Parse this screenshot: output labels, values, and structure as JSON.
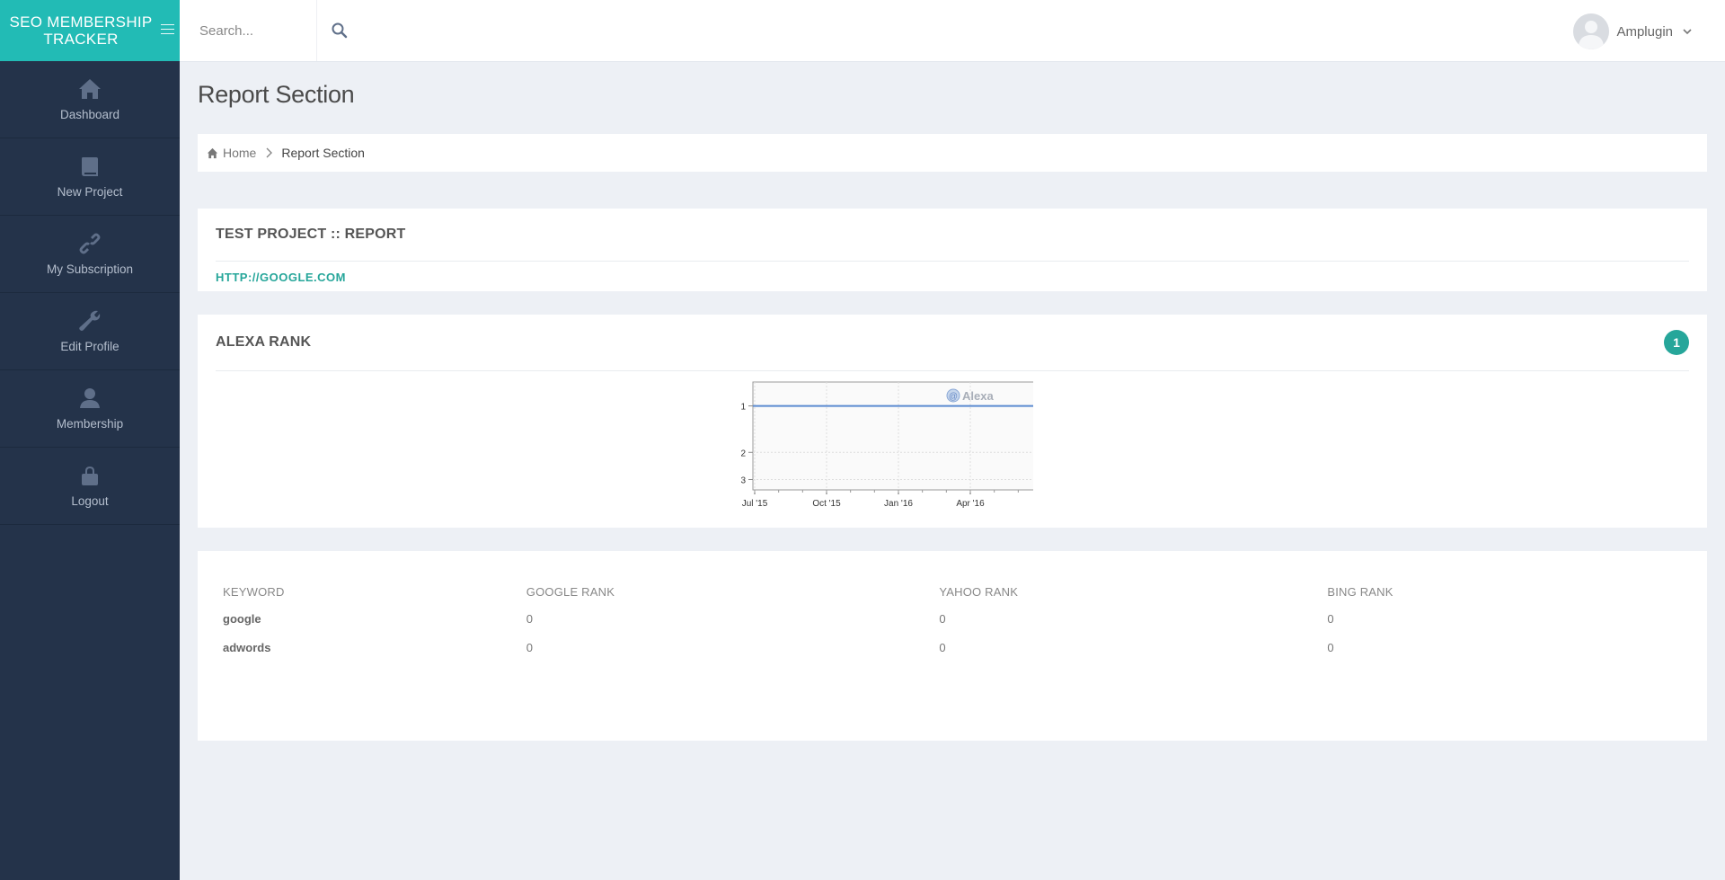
{
  "brand": {
    "title": "SEO MEMBERSHIP TRACKER"
  },
  "sidebar": {
    "items": [
      {
        "label": "Dashboard",
        "icon": "home-icon"
      },
      {
        "label": "New Project",
        "icon": "book-icon"
      },
      {
        "label": "My Subscription",
        "icon": "link-icon"
      },
      {
        "label": "Edit Profile",
        "icon": "wrench-icon"
      },
      {
        "label": "Membership",
        "icon": "user-icon"
      },
      {
        "label": "Logout",
        "icon": "lock-icon"
      }
    ]
  },
  "topbar": {
    "search_placeholder": "Search...",
    "user_name": "Amplugin"
  },
  "page": {
    "title": "Report Section",
    "breadcrumb": {
      "home": "Home",
      "current": "Report Section"
    }
  },
  "project": {
    "title": "TEST PROJECT :: REPORT",
    "url": "HTTP://GOOGLE.COM"
  },
  "alexa": {
    "title": "ALEXA RANK",
    "badge": "1",
    "watermark": "Alexa"
  },
  "chart_data": {
    "type": "line",
    "title": "",
    "xlabel": "",
    "ylabel": "",
    "x_ticks": [
      "Jul '15",
      "Oct '15",
      "Jan '16",
      "Apr '16"
    ],
    "y_ticks": [
      "1",
      "2",
      "3"
    ],
    "y_scale": "log",
    "y_inverted": true,
    "series": [
      {
        "values": [
          1,
          1
        ]
      }
    ],
    "colors": {
      "line": "#5b8bd0"
    }
  },
  "keywords": {
    "headers": [
      "KEYWORD",
      "GOOGLE RANK",
      "YAHOO RANK",
      "BING RANK"
    ],
    "rows": [
      [
        "google",
        "0",
        "0",
        "0"
      ],
      [
        "adwords",
        "0",
        "0",
        "0"
      ]
    ]
  },
  "colors": {
    "brand": "#22bbb5",
    "sidebar": "#24334a",
    "accent": "#26a69a",
    "background": "#edf0f5"
  }
}
